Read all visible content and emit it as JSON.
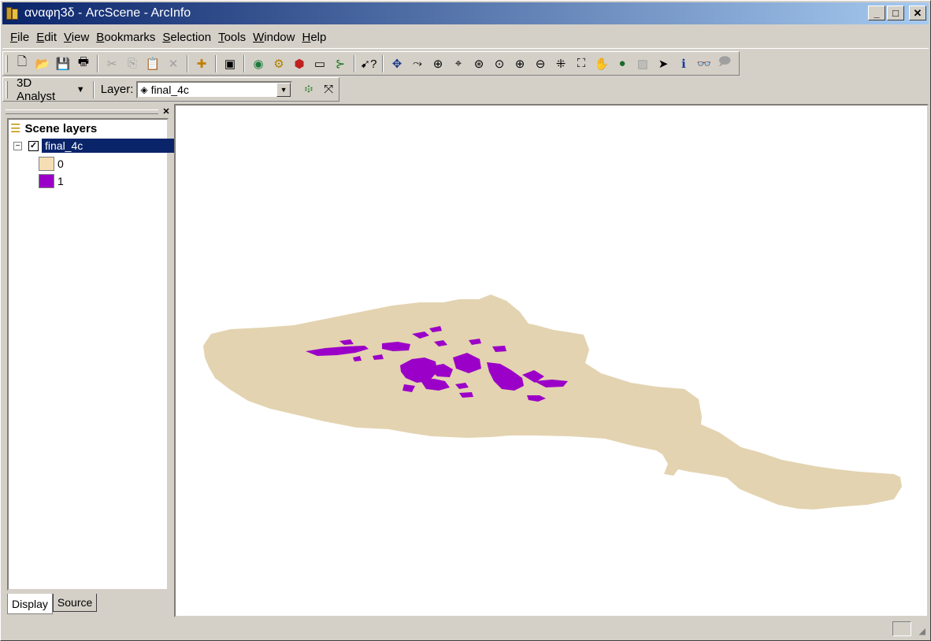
{
  "window": {
    "title": "αναφη3δ - ArcScene - ArcInfo",
    "minimize": "_",
    "maximize": "□",
    "close": "✕"
  },
  "menu": [
    {
      "key": "F",
      "rest": "ile"
    },
    {
      "key": "E",
      "rest": "dit"
    },
    {
      "key": "V",
      "rest": "iew"
    },
    {
      "key": "B",
      "rest": "ookmarks"
    },
    {
      "key": "S",
      "rest": "election"
    },
    {
      "key": "T",
      "rest": "ools"
    },
    {
      "key": "W",
      "rest": "indow"
    },
    {
      "key": "H",
      "rest": "elp"
    }
  ],
  "toolbar_3d": {
    "analyst_label": "3D Analyst",
    "layer_label": "Layer:",
    "layer_value": "final_4c"
  },
  "toc": {
    "root_label": "Scene layers",
    "layer": {
      "name": "final_4c",
      "checked": "✓",
      "expander": "−"
    },
    "legend": [
      {
        "label": "0",
        "color": "#f5deb3"
      },
      {
        "label": "1",
        "color": "#9b00c8"
      }
    ],
    "tabs": [
      "Display",
      "Source"
    ]
  },
  "scene": {
    "background": "#ffffff",
    "terrain_color": "#e3d3b0",
    "class1_color": "#9b00c8"
  }
}
